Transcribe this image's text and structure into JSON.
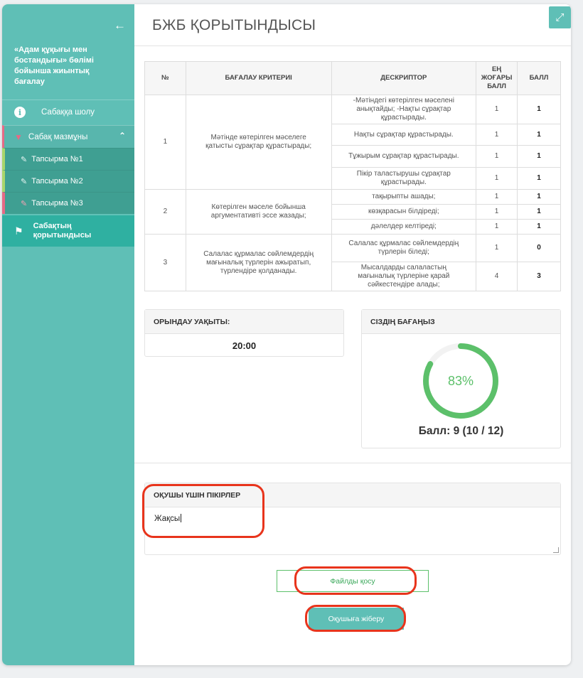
{
  "sidebar": {
    "course_title": "«Адам құқығы мен бостандығы» бөлімі бойынша жиынтық бағалау",
    "overview_label": "Сабаққа шолу",
    "content_label": "Сабақ мазмұны",
    "tasks": [
      "Тапсырма №1",
      "Тапсырма №2",
      "Тапсырма №3"
    ],
    "results_label": "Сабақтың қорытындысы"
  },
  "main": {
    "title": "БЖБ ҚОРЫТЫНДЫСЫ"
  },
  "table": {
    "headers": {
      "num": "№",
      "criteria": "БАҒАЛАУ КРИТЕРИІ",
      "descriptor": "ДЕСКРИПТОР",
      "max": "ЕҢ ЖОҒАРЫ БАЛЛ",
      "score": "БАЛЛ"
    },
    "groups": [
      {
        "num": "1",
        "criterion": " Мәтінде көтерілген мәселеге қатысты сұрақтар құрастырады;",
        "rows": [
          {
            "descriptor": "-Мәтіндегі көтерілген мәселені анықтайды; -Нақты сұрақтар құрастырады.",
            "max": "1",
            "score": "1"
          },
          {
            "descriptor": "Нақты сұрақтар құрастырады.",
            "max": "1",
            "score": "1"
          },
          {
            "descriptor": "Тұжырым сұрақтар құрастырады.",
            "max": "1",
            "score": "1"
          },
          {
            "descriptor": "Пікір таластырушы сұрақтар құрастырады.",
            "max": "1",
            "score": "1"
          }
        ]
      },
      {
        "num": "2",
        "criterion": " Көтерілген мәселе бойынша аргументативті эссе жазады;",
        "rows": [
          {
            "descriptor": "тақырыпты ашады;",
            "max": "1",
            "score": "1"
          },
          {
            "descriptor": "көзқарасын білдіреді;",
            "max": "1",
            "score": "1"
          },
          {
            "descriptor": "дәлелдер келтіреді;",
            "max": "1",
            "score": "1"
          }
        ]
      },
      {
        "num": "3",
        "criterion": " Салалас құрмалас сөйлемдердің мағыналық түрлерін ажыратып, түрлендіре қолданады.",
        "rows": [
          {
            "descriptor": "Салалас құрмалас сөйлемдердің түрлерін біледі;",
            "max": "1",
            "score": "0"
          },
          {
            "descriptor": "Мысалдарды салаластың мағыналық түрлеріне қарай сәйкестендіре алады;",
            "max": "4",
            "score": "3"
          }
        ]
      }
    ]
  },
  "time": {
    "label": "ОРЫНДАУ УАҚЫТЫ:",
    "value": "20:00"
  },
  "grade": {
    "label": "СІЗДІҢ БАҒАҢЫЗ",
    "percent_text": "83%",
    "fraction": 0.83,
    "score_text": "Балл: 9 (10 / 12)",
    "ring_color": "#5cc06a"
  },
  "comments": {
    "label": "ОҚУШЫ ҮШІН ПІКІРЛЕР",
    "value": "Жақсы"
  },
  "buttons": {
    "add_file": "Файлды қосу",
    "send": "Оқушыға жіберу"
  },
  "colors": {
    "accent": "#5fbfb6",
    "annotation": "#e8341c"
  }
}
